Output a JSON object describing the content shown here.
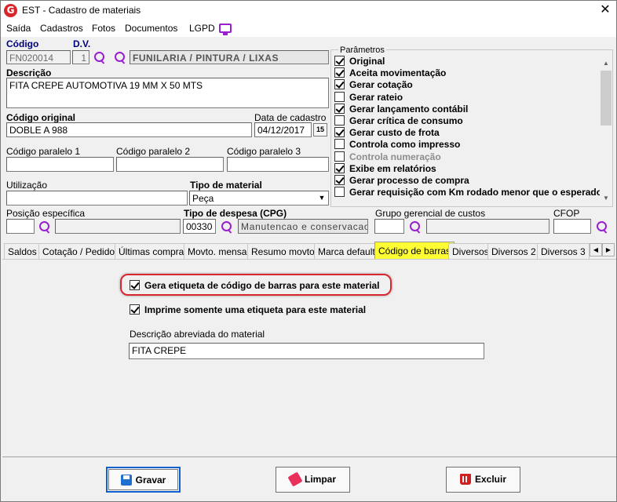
{
  "window": {
    "title": "EST - Cadastro de materiais",
    "logo_letter": "G"
  },
  "menu": [
    "Saída",
    "Cadastros",
    "Fotos",
    "Documentos",
    "LGPD"
  ],
  "form": {
    "codigo_label": "Código",
    "codigo_value": "FN020014",
    "dv_label": "D.V.",
    "dv_value": "1",
    "grupo_value": "FUNILARIA / PINTURA / LIXAS",
    "descricao_label": "Descrição",
    "descricao_value": "FITA CREPE AUTOMOTIVA 19 MM X 50 MTS",
    "codigo_original_label": "Código original",
    "codigo_original_value": "DOBLE A 988",
    "data_cadastro_label": "Data de cadastro",
    "data_cadastro_value": "04/12/2017",
    "cal_label": "15",
    "cod_par1_label": "Código paralelo 1",
    "cod_par2_label": "Código paralelo 2",
    "cod_par3_label": "Código paralelo 3",
    "utilizacao_label": "Utilização",
    "tipo_material_label": "Tipo de material",
    "tipo_material_value": "Peça",
    "posicao_label": "Posição específica",
    "tipo_despesa_label": "Tipo de despesa (CPG)",
    "tipo_despesa_code": "00330",
    "tipo_despesa_value": "Manutencao e conservacao",
    "grupo_gerencial_label": "Grupo gerencial de custos",
    "cfop_label": "CFOP"
  },
  "parametros": {
    "title": "Parâmetros",
    "items": [
      {
        "label": "Original",
        "checked": true,
        "disabled": false
      },
      {
        "label": "Aceita movimentação",
        "checked": true,
        "disabled": false
      },
      {
        "label": "Gerar cotação",
        "checked": true,
        "disabled": false
      },
      {
        "label": "Gerar rateio",
        "checked": false,
        "disabled": false
      },
      {
        "label": "Gerar lançamento contábil",
        "checked": true,
        "disabled": false
      },
      {
        "label": "Gerar crítica de consumo",
        "checked": false,
        "disabled": false
      },
      {
        "label": "Gerar custo de frota",
        "checked": true,
        "disabled": false
      },
      {
        "label": "Controla como impresso",
        "checked": false,
        "disabled": false
      },
      {
        "label": "Controla numeração",
        "checked": false,
        "disabled": true
      },
      {
        "label": "Exibe em relatórios",
        "checked": true,
        "disabled": false
      },
      {
        "label": "Gerar processo de compra",
        "checked": true,
        "disabled": false
      },
      {
        "label": "Gerar requisição com Km rodado menor que o esperado",
        "checked": false,
        "disabled": false
      }
    ]
  },
  "tabs": [
    "Saldos",
    "Cotação / Pedido",
    "Últimas compras",
    "Movto. mensal",
    "Resumo movto.",
    "Marca default",
    "Código de barras",
    "Diversos",
    "Diversos 2",
    "Diversos 3"
  ],
  "active_tab": "Código de barras",
  "barcode_panel": {
    "gera_etiqueta_label": "Gera etiqueta de código de barras para este material",
    "imprime_somente_label": "Imprime somente uma etiqueta para este material",
    "descricao_abreviada_label": "Descrição abreviada do material",
    "descricao_abreviada_value": "FITA CREPE"
  },
  "buttons": {
    "gravar": "Gravar",
    "limpar": "Limpar",
    "excluir": "Excluir"
  },
  "colors": {
    "accent_purple": "#9b1fd1",
    "active_tab": "#ffff33",
    "highlight_red": "#d7262e",
    "primary_blue": "#0f5fcf"
  }
}
